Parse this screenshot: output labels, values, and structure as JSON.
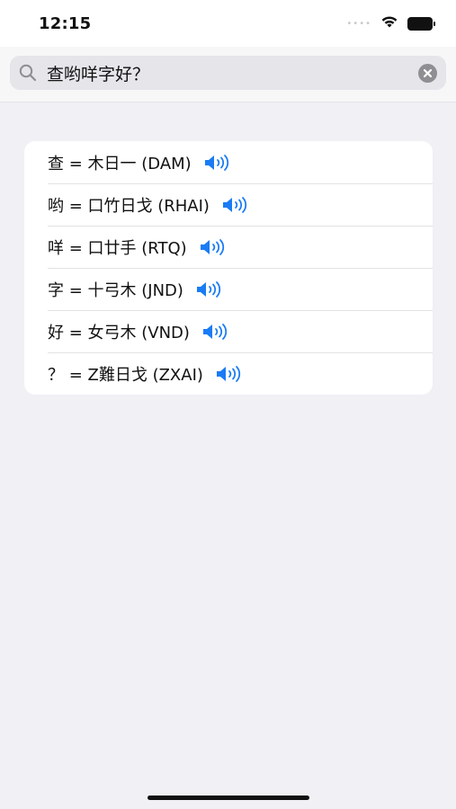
{
  "status_bar": {
    "time": "12:15",
    "icons": [
      "cellular-dots-icon",
      "wifi-icon",
      "battery-icon"
    ]
  },
  "search": {
    "value": "查哟咩字好？",
    "icon": "search-icon",
    "clear_icon": "clear-icon"
  },
  "results": [
    {
      "text": "查 = 木日一 (DAM)",
      "icon": "speaker-icon"
    },
    {
      "text": "哟 = 口竹日戈 (RHAI)",
      "icon": "speaker-icon"
    },
    {
      "text": "咩 = 口廿手 (RTQ)",
      "icon": "speaker-icon"
    },
    {
      "text": "字 = 十弓木 (JND)",
      "icon": "speaker-icon"
    },
    {
      "text": "好 = 女弓木 (VND)",
      "icon": "speaker-icon"
    },
    {
      "text": "？ = Z難日戈 (ZXAI)",
      "icon": "speaker-icon"
    }
  ],
  "colors": {
    "accent": "#1a7cf5",
    "background": "#f0f0f5"
  }
}
